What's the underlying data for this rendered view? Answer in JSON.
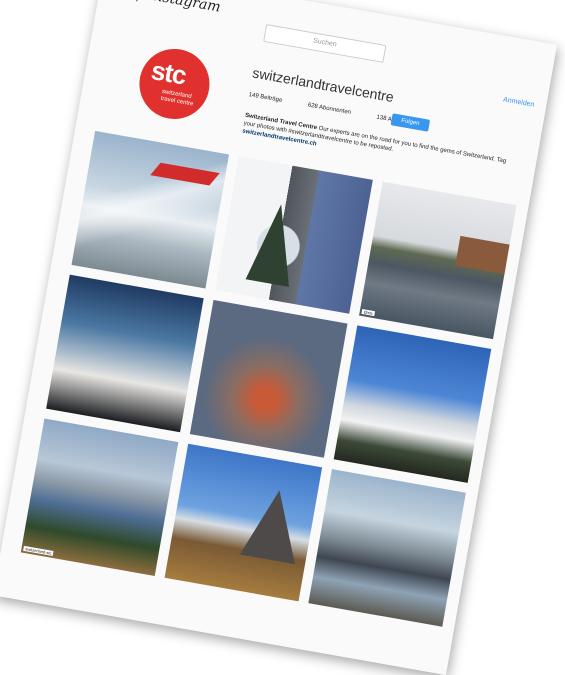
{
  "header": {
    "app_name": "Instagram",
    "search_placeholder": "Suchen",
    "login_label": "Anmelden"
  },
  "profile": {
    "avatar_text": "stc",
    "avatar_subtext": "switzerland travel centre",
    "username": "switzerlandtravelcentre",
    "posts": "149 Beiträge",
    "followers": "628 Abonnenten",
    "following": "138 Abonniert",
    "follow_label": "Folgen",
    "bio_name": "Switzerland Travel Centre",
    "bio_text": "Our experts are on the road for you to find the gems of Switzerland. Tag your photos with #switzerlandtravelcentre to be reposted.",
    "bio_link": "switzerlandtravelcentre.ch"
  },
  "grid": {
    "captions": [
      "",
      "",
      "",
      "",
      "",
      "",
      "",
      "",
      ""
    ]
  },
  "captions_overlay": {
    "tile2": "@stc",
    "tile6": "switzerland-stc"
  },
  "colors": {
    "brand_red": "#e0312e",
    "accent_blue": "#3897f0"
  }
}
